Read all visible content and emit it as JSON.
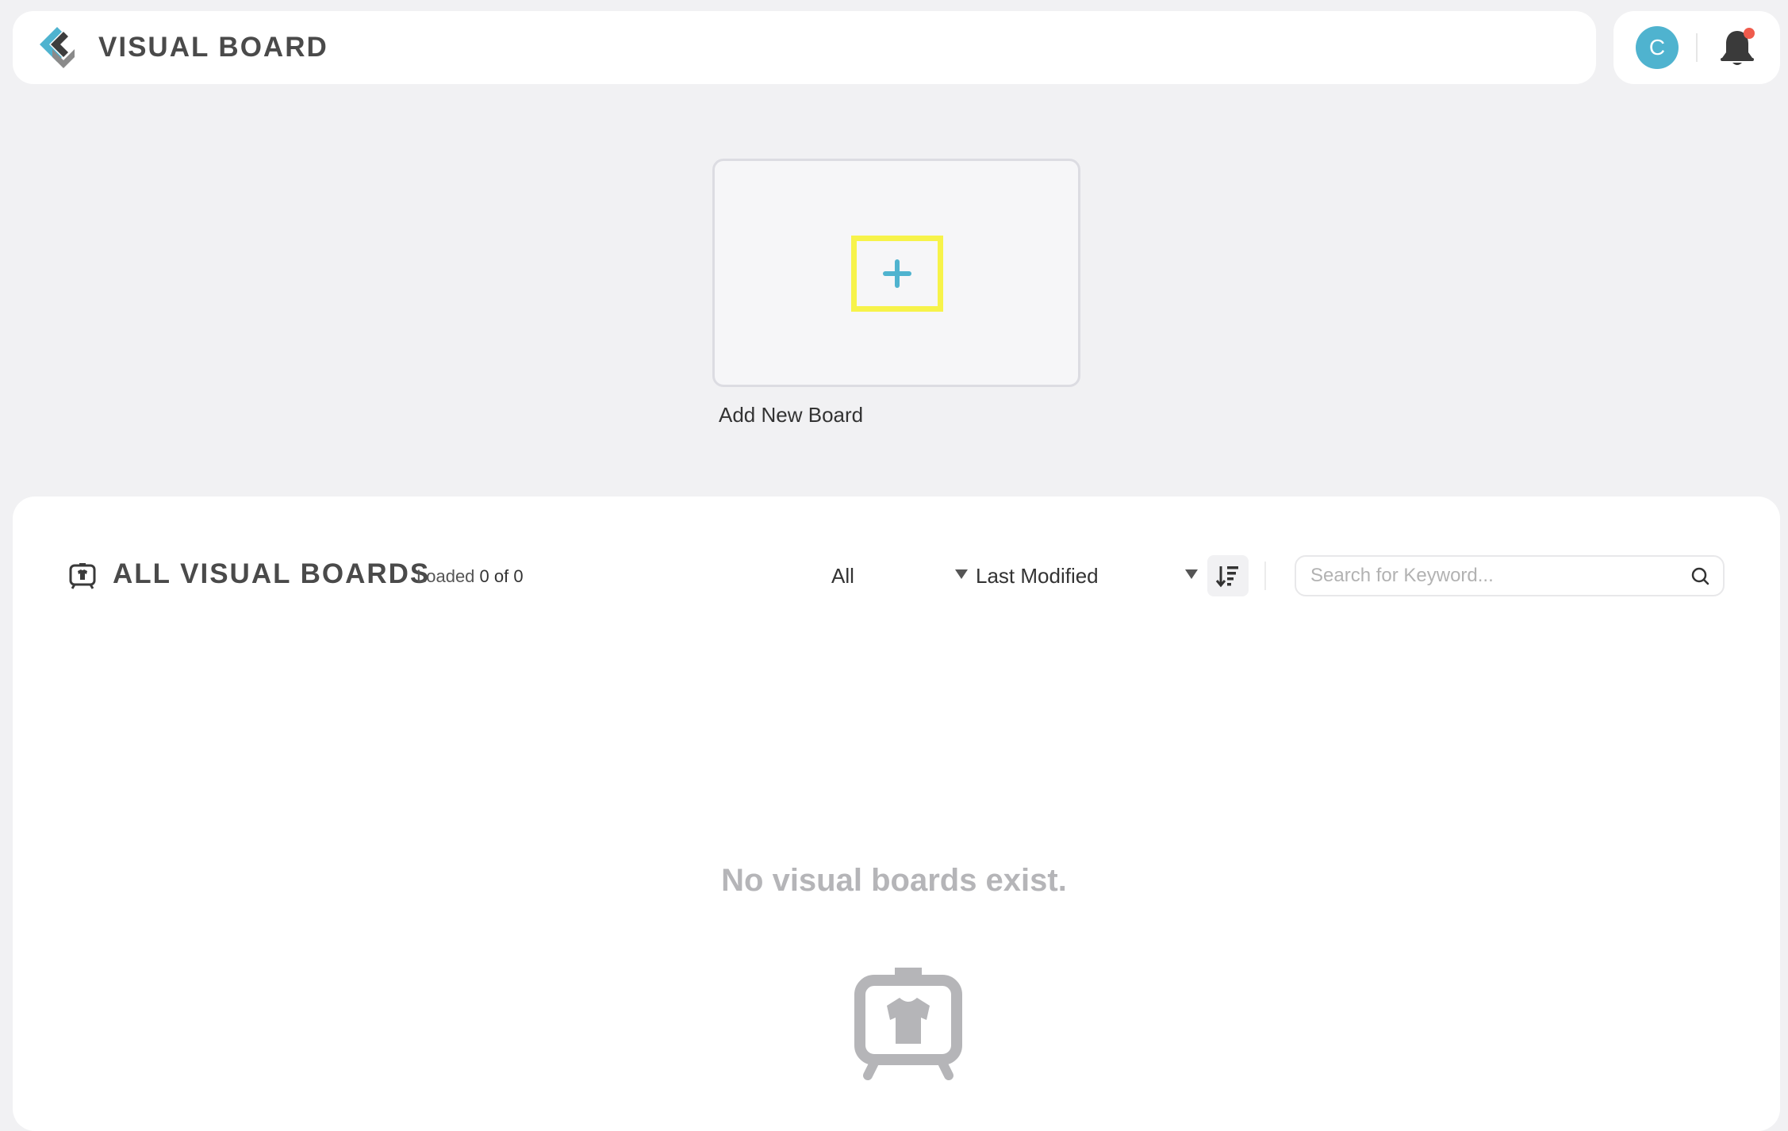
{
  "app": {
    "title": "VISUAL BOARD",
    "accent_color": "#4fb3cf",
    "logo_icon": "visual-board-logo"
  },
  "user": {
    "avatar_initial": "C",
    "notification_icon": "bell-icon",
    "has_unread": true
  },
  "add_board": {
    "label": "Add New Board",
    "icon": "plus-icon",
    "highlight_color": "#f7f34a"
  },
  "boards_section": {
    "title": "ALL VISUAL BOARDS",
    "icon": "visual-board-icon",
    "loaded_prefix": "Loaded",
    "loaded_count": "0 of 0",
    "filter": {
      "selected": "All"
    },
    "sort": {
      "selected": "Last Modified",
      "order_icon": "sort-descending-icon"
    },
    "search": {
      "placeholder": "Search for Keyword...",
      "value": ""
    },
    "empty_message": "No visual boards exist.",
    "empty_icon": "visual-board-empty-icon"
  }
}
